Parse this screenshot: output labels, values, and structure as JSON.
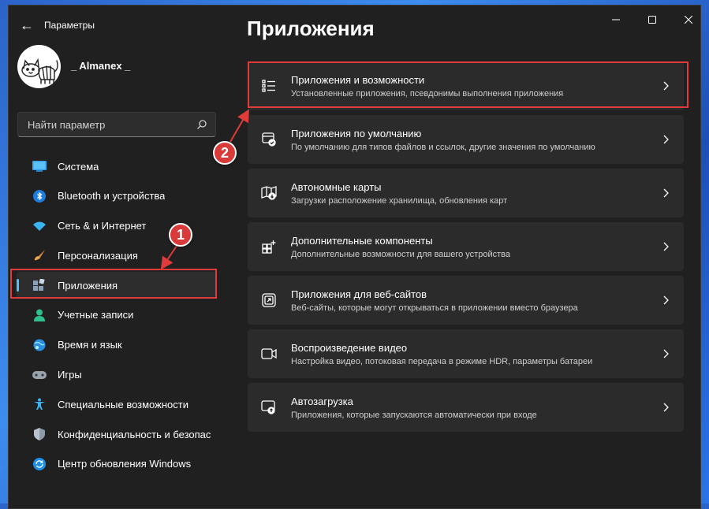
{
  "window": {
    "app_title": "Параметры",
    "back_icon": "back-arrow-icon",
    "controls": [
      "minimize-icon",
      "maximize-icon",
      "close-icon"
    ]
  },
  "profile": {
    "user_name": "_ Almanex _",
    "avatar_icon": "cat-avatar"
  },
  "search": {
    "placeholder": "Найти параметр",
    "value": "",
    "icon": "search-icon"
  },
  "sidebar": {
    "items": [
      {
        "label": "Система",
        "icon": "system-display-icon",
        "active": false
      },
      {
        "label": "Bluetooth и устройства",
        "icon": "bluetooth-icon",
        "active": false
      },
      {
        "label": "Сеть & и Интернет",
        "icon": "wifi-icon",
        "active": false
      },
      {
        "label": "Персонализация",
        "icon": "brush-icon",
        "active": false
      },
      {
        "label": "Приложения",
        "icon": "apps-icon",
        "active": true
      },
      {
        "label": "Учетные записи",
        "icon": "account-icon",
        "active": false
      },
      {
        "label": "Время и язык",
        "icon": "time-language-icon",
        "active": false
      },
      {
        "label": "Игры",
        "icon": "gamepad-icon",
        "active": false
      },
      {
        "label": "Специальные возможности",
        "icon": "accessibility-icon",
        "active": false
      },
      {
        "label": "Конфиденциальность и безопас",
        "icon": "shield-icon",
        "active": false
      },
      {
        "label": "Центр обновления Windows",
        "icon": "windows-update-icon",
        "active": false
      }
    ]
  },
  "main": {
    "page_title": "Приложения",
    "cards": [
      {
        "title": "Приложения и возможности",
        "desc": "Установленные приложения, псевдонимы выполнения приложения",
        "icon": "apps-list-icon"
      },
      {
        "title": "Приложения по умолчанию",
        "desc": "По умолчанию для типов файлов и ссылок, другие значения по умолчанию",
        "icon": "default-apps-icon"
      },
      {
        "title": "Автономные карты",
        "desc": "Загрузки расположение хранилища, обновления карт",
        "icon": "offline-maps-icon"
      },
      {
        "title": "Дополнительные компоненты",
        "desc": "Дополнительные возможности для вашего устройства",
        "icon": "optional-features-icon"
      },
      {
        "title": "Приложения для веб-сайтов",
        "desc": "Веб-сайты, которые могут открываться в приложении вместо браузера",
        "icon": "web-apps-icon"
      },
      {
        "title": "Воспроизведение видео",
        "desc": "Настройка видео, потоковая передача в режиме HDR, параметры батареи",
        "icon": "video-playback-icon"
      },
      {
        "title": "Автозагрузка",
        "desc": "Приложения, которые запускаются автоматически при входе",
        "icon": "startup-icon"
      }
    ]
  },
  "annotations": {
    "callout_1": "1",
    "callout_2": "2",
    "color": "#e03b3b"
  },
  "colors": {
    "accent": "#4cc2ff",
    "background": "#202020",
    "card": "#2b2b2b"
  }
}
